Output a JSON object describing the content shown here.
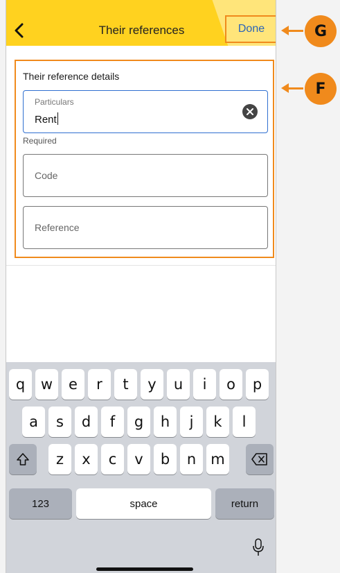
{
  "header": {
    "title": "Their references",
    "done_label": "Done"
  },
  "form": {
    "heading": "Their reference details",
    "particulars": {
      "label": "Particulars",
      "value": "Rent"
    },
    "required_text": "Required",
    "code": {
      "placeholder": "Code"
    },
    "reference": {
      "placeholder": "Reference"
    }
  },
  "keyboard": {
    "row1": [
      "q",
      "w",
      "e",
      "r",
      "t",
      "y",
      "u",
      "i",
      "o",
      "p"
    ],
    "row2": [
      "a",
      "s",
      "d",
      "f",
      "g",
      "h",
      "j",
      "k",
      "l"
    ],
    "row3": [
      "z",
      "x",
      "c",
      "v",
      "b",
      "n",
      "m"
    ],
    "numbers_label": "123",
    "space_label": "space",
    "return_label": "return"
  },
  "callouts": {
    "g": "G",
    "f": "F"
  },
  "colors": {
    "header": "#ffd21f",
    "accent": "#f08a1c",
    "done_text": "#2a64b8",
    "active_field_border": "#2f6fd0"
  },
  "icons": [
    "chevron-left-icon",
    "clear-icon",
    "shift-icon",
    "backspace-icon",
    "microphone-icon"
  ]
}
